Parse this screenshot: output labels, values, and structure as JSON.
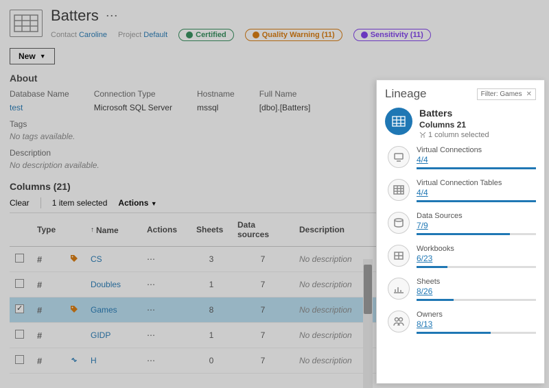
{
  "header": {
    "title": "Batters",
    "contact_label": "Contact",
    "contact": "Caroline",
    "project_label": "Project",
    "project": "Default",
    "badges": {
      "certified": "Certified",
      "warning": "Quality Warning (11)",
      "sensitivity": "Sensitivity (11)"
    },
    "new_button": "New"
  },
  "about": {
    "heading": "About",
    "db_label": "Database Name",
    "db_value": "test",
    "conn_label": "Connection Type",
    "conn_value": "Microsoft SQL Server",
    "host_label": "Hostname",
    "host_value": "mssql",
    "full_label": "Full Name",
    "full_value": "[dbo].[Batters]",
    "tags_label": "Tags",
    "tags_value": "No tags available.",
    "desc_label": "Description",
    "desc_value": "No description available."
  },
  "columns": {
    "heading": "Columns (21)",
    "clear": "Clear",
    "selected": "1 item selected",
    "actions": "Actions",
    "headers": {
      "type": "Type",
      "name": "Name",
      "actions": "Actions",
      "sheets": "Sheets",
      "ds": "Data sources",
      "desc": "Description"
    },
    "rows": [
      {
        "checked": false,
        "tag": true,
        "link": false,
        "name": "CS",
        "sheets": "3",
        "ds": "7",
        "desc": "No description"
      },
      {
        "checked": false,
        "tag": false,
        "link": false,
        "name": "Doubles",
        "sheets": "1",
        "ds": "7",
        "desc": "No description"
      },
      {
        "checked": true,
        "tag": true,
        "link": false,
        "name": "Games",
        "sheets": "8",
        "ds": "7",
        "desc": "No description"
      },
      {
        "checked": false,
        "tag": false,
        "link": false,
        "name": "GIDP",
        "sheets": "1",
        "ds": "7",
        "desc": "No description"
      },
      {
        "checked": false,
        "tag": false,
        "link": true,
        "name": "H",
        "sheets": "0",
        "ds": "7",
        "desc": "No description"
      }
    ]
  },
  "lineage": {
    "title": "Lineage",
    "filter_label": "Filter: Games",
    "top": {
      "name": "Batters",
      "cols": "Columns 21",
      "sel": "1 column selected"
    },
    "items": [
      {
        "name": "Virtual Connections",
        "count": "4/4",
        "pct": 100
      },
      {
        "name": "Virtual Connection Tables",
        "count": "4/4",
        "pct": 100
      },
      {
        "name": "Data Sources",
        "count": "7/9",
        "pct": 78
      },
      {
        "name": "Workbooks",
        "count": "6/23",
        "pct": 26
      },
      {
        "name": "Sheets",
        "count": "8/26",
        "pct": 31
      },
      {
        "name": "Owners",
        "count": "8/13",
        "pct": 62
      }
    ]
  }
}
